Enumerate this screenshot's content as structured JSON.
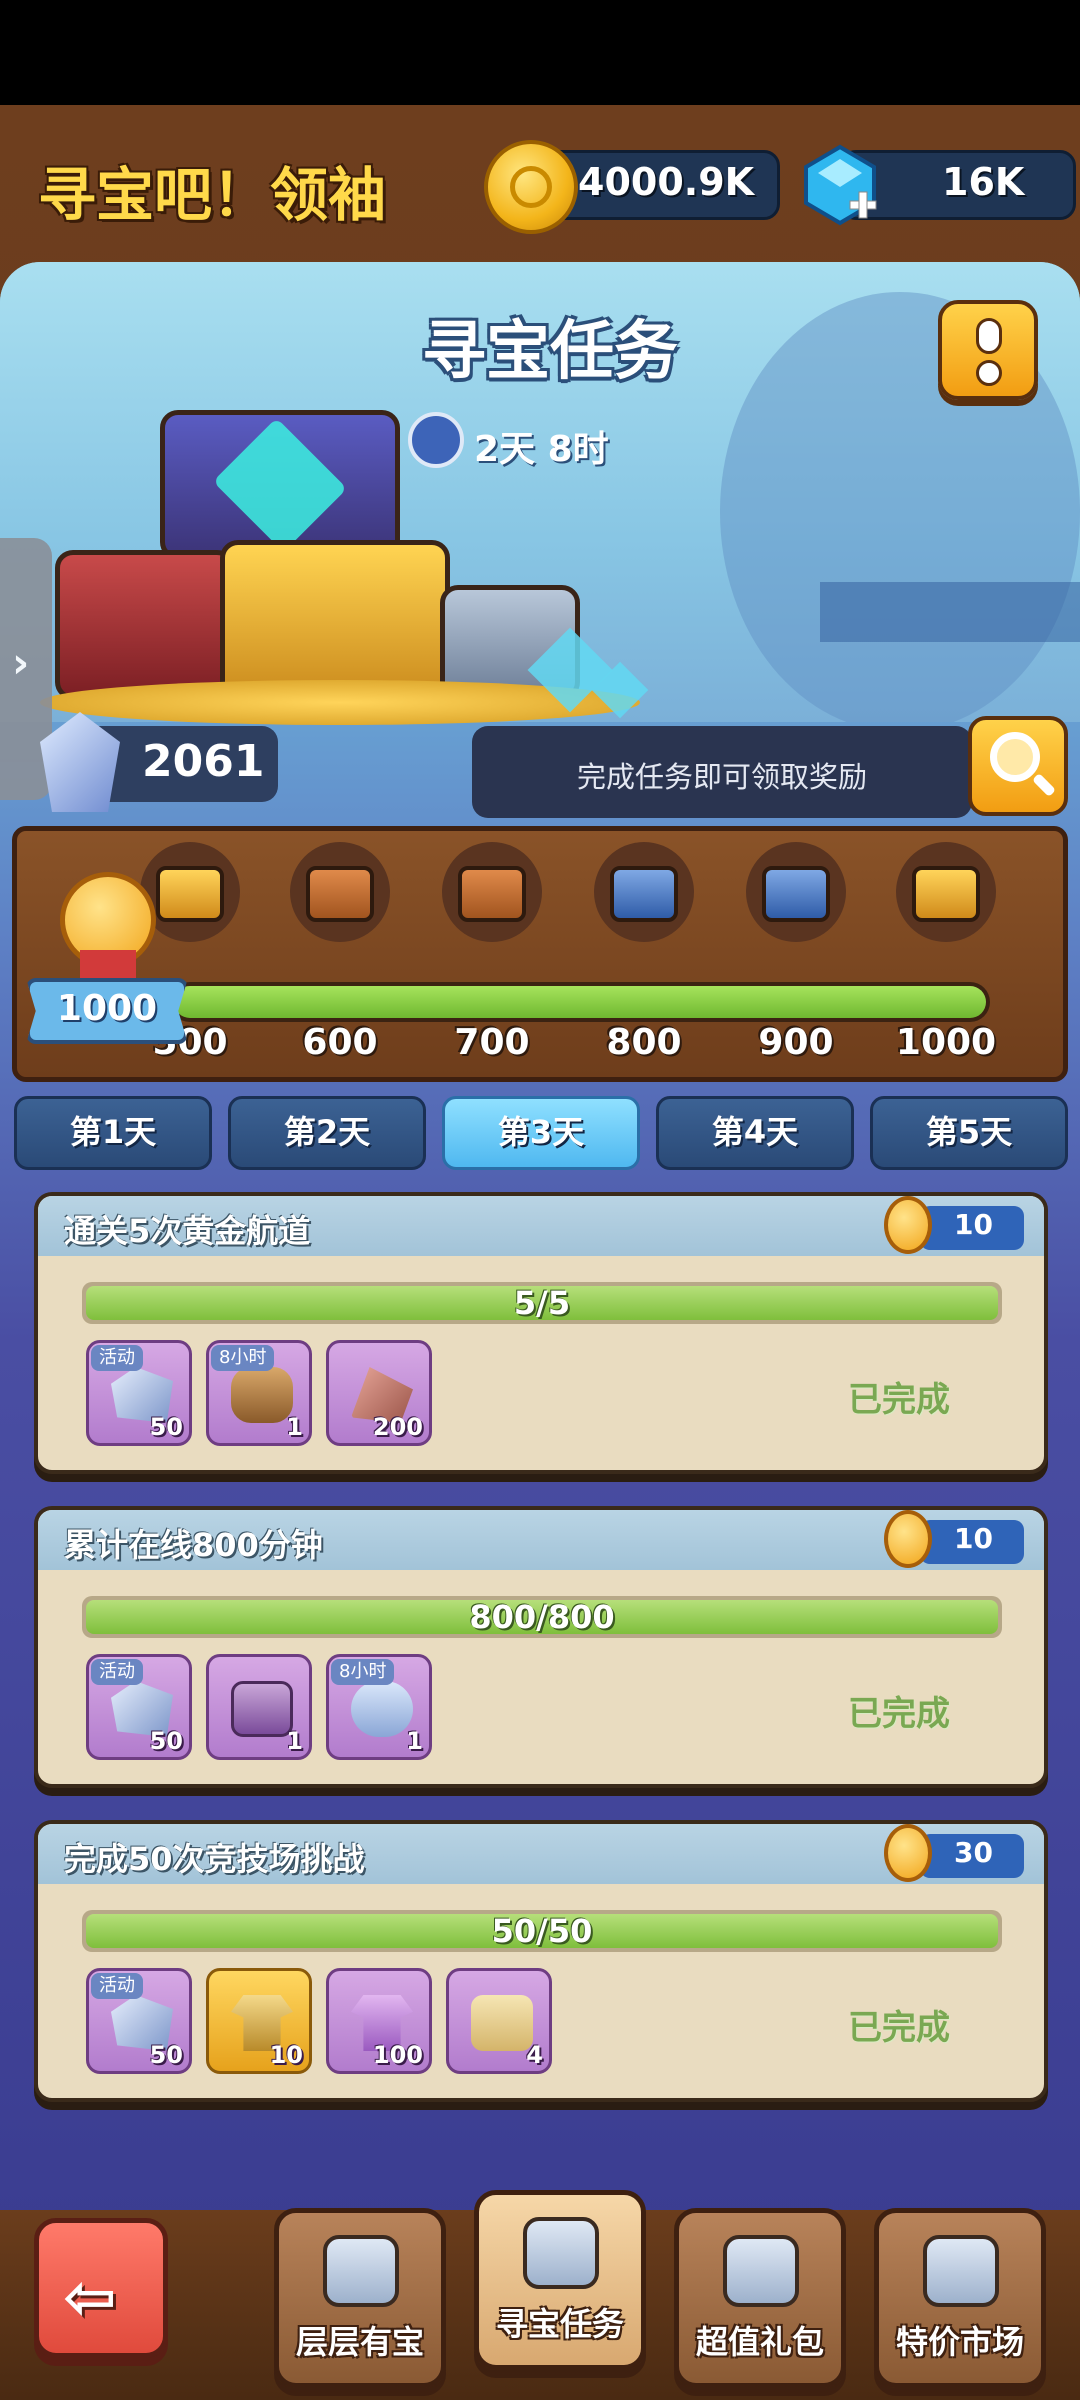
{
  "header": {
    "title": "寻宝吧！领袖",
    "coins": "4000.9K",
    "gems": "16K"
  },
  "event": {
    "title": "寻宝任务",
    "timer": "2天 8时",
    "crystal_count": "2061",
    "hint": "完成任务即可领取奖励"
  },
  "milestones": {
    "current_points": "1000",
    "progress_fraction": 1.0,
    "items": [
      {
        "label": "500",
        "chest": "gold"
      },
      {
        "label": "600",
        "chest": "brown"
      },
      {
        "label": "700",
        "chest": "brown"
      },
      {
        "label": "800",
        "chest": "blue"
      },
      {
        "label": "900",
        "chest": "blue"
      },
      {
        "label": "1000",
        "chest": "gold"
      }
    ]
  },
  "days": [
    {
      "label": "第1天",
      "active": false
    },
    {
      "label": "第2天",
      "active": false
    },
    {
      "label": "第3天",
      "active": true
    },
    {
      "label": "第4天",
      "active": false
    },
    {
      "label": "第5天",
      "active": false
    }
  ],
  "tasks": [
    {
      "title": "通关5次黄金航道",
      "points": "10",
      "progress": "5/5",
      "progress_fraction": 1.0,
      "status": "已完成",
      "rewards": [
        {
          "icon": "crystal-icon",
          "tag": "活动",
          "count": "50"
        },
        {
          "icon": "logs-icon",
          "tag": "8小时",
          "count": "1"
        },
        {
          "icon": "ore-icon",
          "tag": "",
          "count": "200"
        }
      ]
    },
    {
      "title": "累计在线800分钟",
      "points": "10",
      "progress": "800/800",
      "progress_fraction": 1.0,
      "status": "已完成",
      "rewards": [
        {
          "icon": "crystal-icon",
          "tag": "活动",
          "count": "50"
        },
        {
          "icon": "chest-icon",
          "tag": "",
          "count": "1"
        },
        {
          "icon": "cloud-icon",
          "tag": "8小时",
          "count": "1"
        }
      ]
    },
    {
      "title": "完成50次竞技场挑战",
      "points": "30",
      "progress": "50/50",
      "progress_fraction": 1.0,
      "status": "已完成",
      "rewards": [
        {
          "icon": "crystal-icon",
          "tag": "活动",
          "count": "50"
        },
        {
          "icon": "gold-shirt-icon",
          "tag": "",
          "count": "10"
        },
        {
          "icon": "purple-shirt-icon",
          "tag": "",
          "count": "100"
        },
        {
          "icon": "scroll-icon",
          "tag": "",
          "count": "4"
        }
      ]
    }
  ],
  "nav": [
    {
      "label": "层层有宝",
      "icon": "tower-icon",
      "active": false
    },
    {
      "label": "寻宝任务",
      "icon": "clipboard-icon",
      "active": true
    },
    {
      "label": "超值礼包",
      "icon": "gift-icon",
      "active": false
    },
    {
      "label": "特价市场",
      "icon": "shop-icon",
      "active": false
    }
  ]
}
